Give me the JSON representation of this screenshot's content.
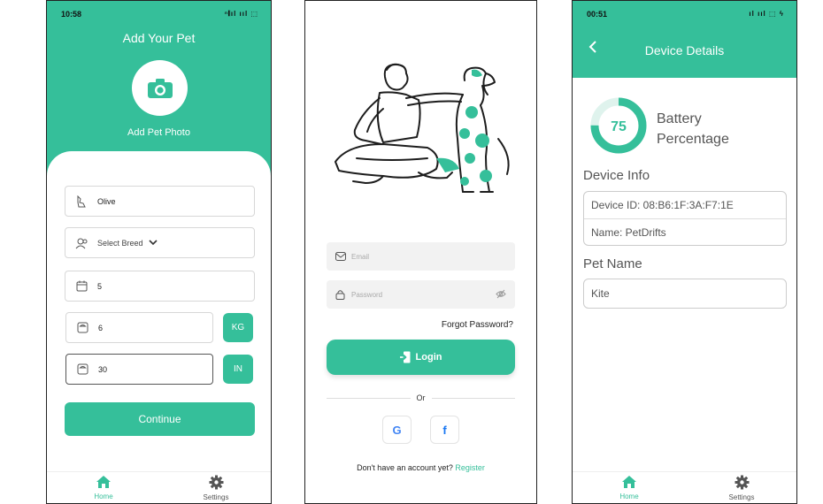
{
  "add_pet": {
    "status_time": "10:58",
    "status_right": "ⁿ𝄃ıl ııl ⬚",
    "title": "Add Your Pet",
    "photo_label": "Add Pet Photo",
    "name_value": "Olive",
    "breed_placeholder": "Select Breed",
    "age_value": "5",
    "weight_value": "6",
    "weight_unit": "KG",
    "height_value": "30",
    "height_unit": "IN",
    "continue_label": "Continue",
    "nav": {
      "home": "Home",
      "settings": "Settings"
    }
  },
  "login": {
    "email_placeholder": "Email",
    "password_placeholder": "Password",
    "forgot": "Forgot Password?",
    "login_label": "Login",
    "or_label": "Or",
    "google_glyph": "G",
    "facebook_glyph": "f",
    "no_account": "Don't have an account yet?",
    "register": "Register"
  },
  "device": {
    "status_time": "00:51",
    "status_right": "ıl ııl ⬚ ϟ",
    "title": "Device Details",
    "battery_value": "75",
    "battery_fraction": 0.75,
    "battery_label_line1": "Battery",
    "battery_label_line2": "Percentage",
    "device_info_title": "Device Info",
    "device_id": "Device ID: 08:B6:1F:3A:F7:1E",
    "device_name": "Name: PetDrifts",
    "pet_name_title": "Pet Name",
    "pet_name_value": "Kite",
    "nav": {
      "home": "Home",
      "settings": "Settings"
    }
  },
  "colors": {
    "accent": "#35bf9a",
    "accent_light": "#dff3ed"
  }
}
